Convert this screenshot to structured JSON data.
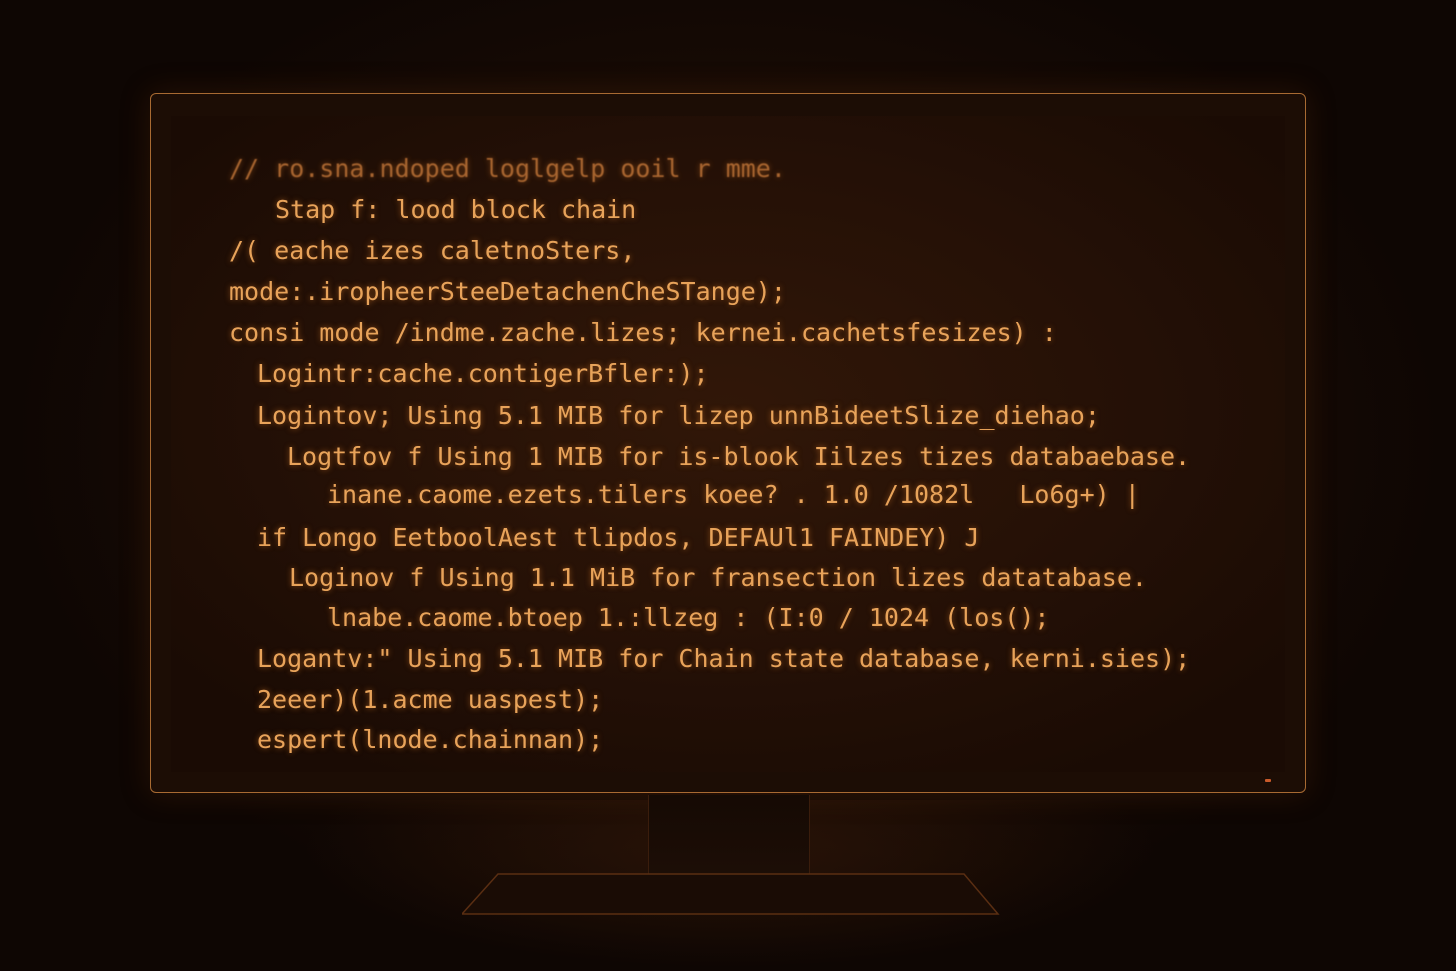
{
  "screen": {
    "code_lines": [
      "// ro.sna.ndoped loglgelp ooil r mme.",
      "Stap f: lood block chain",
      "/( eache izes caletnoSters,",
      "mode:.iropheerSteeDetachenCheSTange);",
      "consi mode /indme.zache.lizes; kernei.cachetsfesizes) :",
      "Logintr:cache.contigerBfler:);",
      "Logintov; Using 5.1 MIB for lizep unnBideetSlize_diehao;",
      "Logtfov f Using 1 MIB for is-blook Iilzes tizes databaebase.",
      "inane.caome.ezets.tilers koee? . 1.0 /1082l   Lo6g+) |",
      "if Longo EetboolAest tlipdos, DEFAUl1 FAINDEY) J",
      "Loginov f Using 1.1 MiB for fransection lizes datatabase.",
      "lnabe.caome.btoep 1.:llzeg : (I:0 / 1024 (los();",
      "Logantv:\" Using 5.1 MIB for Chain state database, kerni.sies);",
      "2eeer)(1.acme uaspest);",
      "espert(lnode.chainnan);"
    ]
  },
  "colors": {
    "text": "#e8a35a",
    "bezel_border": "#a86a32",
    "background": "#120804"
  }
}
